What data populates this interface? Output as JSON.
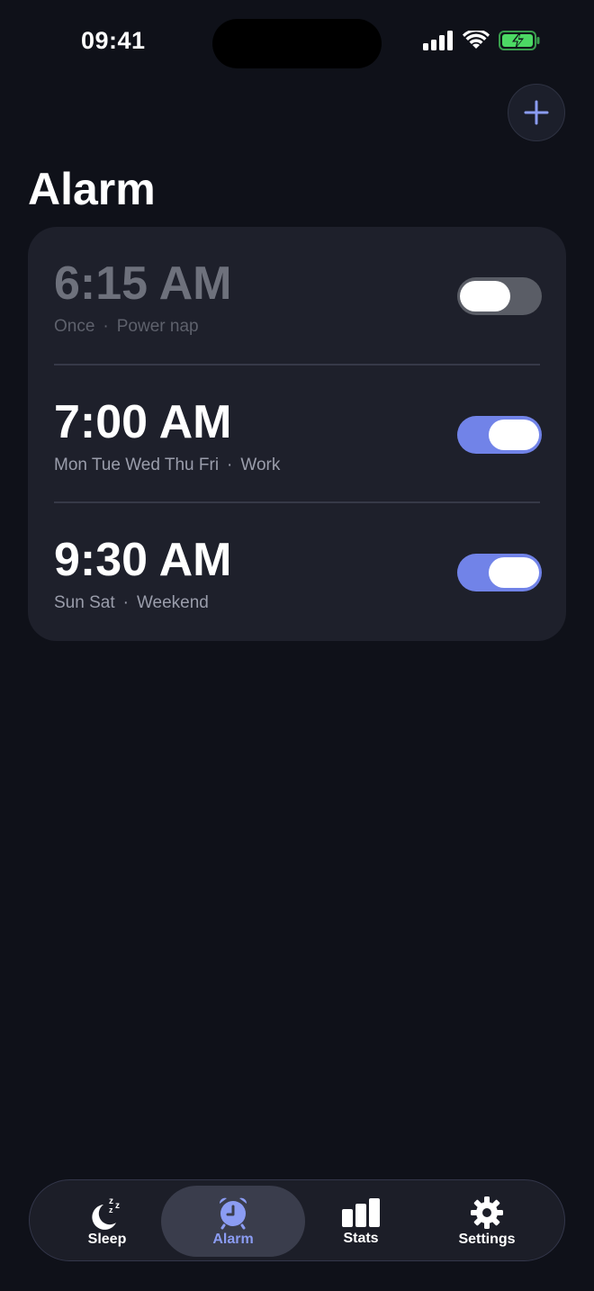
{
  "status_bar": {
    "time": "09:41"
  },
  "header": {
    "title": "Alarm"
  },
  "alarms": [
    {
      "time": "6:15 AM",
      "days": "Once",
      "label": "Power nap",
      "enabled": false
    },
    {
      "time": "7:00 AM",
      "days": "Mon Tue Wed Thu Fri",
      "label": "Work",
      "enabled": true
    },
    {
      "time": "9:30 AM",
      "days": "Sun Sat",
      "label": "Weekend",
      "enabled": true
    }
  ],
  "separator": "·",
  "tab_bar": {
    "tabs": [
      {
        "label": "Sleep",
        "icon": "moon-zzz-icon",
        "active": false
      },
      {
        "label": "Alarm",
        "icon": "alarm-clock-icon",
        "active": true
      },
      {
        "label": "Stats",
        "icon": "bar-chart-icon",
        "active": false
      },
      {
        "label": "Settings",
        "icon": "gear-icon",
        "active": false
      }
    ]
  },
  "colors": {
    "background": "#0f1119",
    "card": "#1e202b",
    "accent": "#7183e8",
    "active_tab_label": "#8b9cf3",
    "battery_green": "#4cd964"
  }
}
